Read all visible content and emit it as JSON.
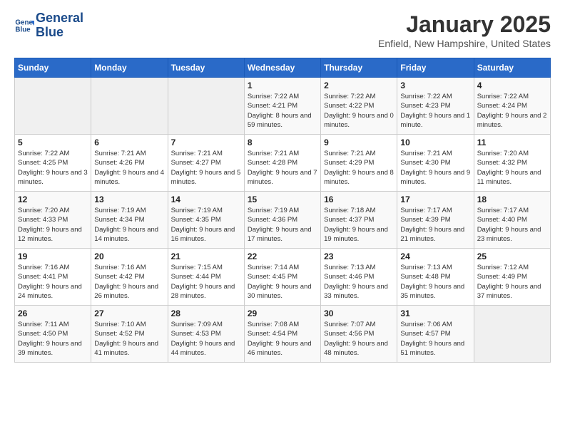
{
  "header": {
    "logo_line1": "General",
    "logo_line2": "Blue",
    "month": "January 2025",
    "location": "Enfield, New Hampshire, United States"
  },
  "weekdays": [
    "Sunday",
    "Monday",
    "Tuesday",
    "Wednesday",
    "Thursday",
    "Friday",
    "Saturday"
  ],
  "weeks": [
    [
      {
        "day": "",
        "info": ""
      },
      {
        "day": "",
        "info": ""
      },
      {
        "day": "",
        "info": ""
      },
      {
        "day": "1",
        "info": "Sunrise: 7:22 AM\nSunset: 4:21 PM\nDaylight: 8 hours and 59 minutes."
      },
      {
        "day": "2",
        "info": "Sunrise: 7:22 AM\nSunset: 4:22 PM\nDaylight: 9 hours and 0 minutes."
      },
      {
        "day": "3",
        "info": "Sunrise: 7:22 AM\nSunset: 4:23 PM\nDaylight: 9 hours and 1 minute."
      },
      {
        "day": "4",
        "info": "Sunrise: 7:22 AM\nSunset: 4:24 PM\nDaylight: 9 hours and 2 minutes."
      }
    ],
    [
      {
        "day": "5",
        "info": "Sunrise: 7:22 AM\nSunset: 4:25 PM\nDaylight: 9 hours and 3 minutes."
      },
      {
        "day": "6",
        "info": "Sunrise: 7:21 AM\nSunset: 4:26 PM\nDaylight: 9 hours and 4 minutes."
      },
      {
        "day": "7",
        "info": "Sunrise: 7:21 AM\nSunset: 4:27 PM\nDaylight: 9 hours and 5 minutes."
      },
      {
        "day": "8",
        "info": "Sunrise: 7:21 AM\nSunset: 4:28 PM\nDaylight: 9 hours and 7 minutes."
      },
      {
        "day": "9",
        "info": "Sunrise: 7:21 AM\nSunset: 4:29 PM\nDaylight: 9 hours and 8 minutes."
      },
      {
        "day": "10",
        "info": "Sunrise: 7:21 AM\nSunset: 4:30 PM\nDaylight: 9 hours and 9 minutes."
      },
      {
        "day": "11",
        "info": "Sunrise: 7:20 AM\nSunset: 4:32 PM\nDaylight: 9 hours and 11 minutes."
      }
    ],
    [
      {
        "day": "12",
        "info": "Sunrise: 7:20 AM\nSunset: 4:33 PM\nDaylight: 9 hours and 12 minutes."
      },
      {
        "day": "13",
        "info": "Sunrise: 7:19 AM\nSunset: 4:34 PM\nDaylight: 9 hours and 14 minutes."
      },
      {
        "day": "14",
        "info": "Sunrise: 7:19 AM\nSunset: 4:35 PM\nDaylight: 9 hours and 16 minutes."
      },
      {
        "day": "15",
        "info": "Sunrise: 7:19 AM\nSunset: 4:36 PM\nDaylight: 9 hours and 17 minutes."
      },
      {
        "day": "16",
        "info": "Sunrise: 7:18 AM\nSunset: 4:37 PM\nDaylight: 9 hours and 19 minutes."
      },
      {
        "day": "17",
        "info": "Sunrise: 7:17 AM\nSunset: 4:39 PM\nDaylight: 9 hours and 21 minutes."
      },
      {
        "day": "18",
        "info": "Sunrise: 7:17 AM\nSunset: 4:40 PM\nDaylight: 9 hours and 23 minutes."
      }
    ],
    [
      {
        "day": "19",
        "info": "Sunrise: 7:16 AM\nSunset: 4:41 PM\nDaylight: 9 hours and 24 minutes."
      },
      {
        "day": "20",
        "info": "Sunrise: 7:16 AM\nSunset: 4:42 PM\nDaylight: 9 hours and 26 minutes."
      },
      {
        "day": "21",
        "info": "Sunrise: 7:15 AM\nSunset: 4:44 PM\nDaylight: 9 hours and 28 minutes."
      },
      {
        "day": "22",
        "info": "Sunrise: 7:14 AM\nSunset: 4:45 PM\nDaylight: 9 hours and 30 minutes."
      },
      {
        "day": "23",
        "info": "Sunrise: 7:13 AM\nSunset: 4:46 PM\nDaylight: 9 hours and 33 minutes."
      },
      {
        "day": "24",
        "info": "Sunrise: 7:13 AM\nSunset: 4:48 PM\nDaylight: 9 hours and 35 minutes."
      },
      {
        "day": "25",
        "info": "Sunrise: 7:12 AM\nSunset: 4:49 PM\nDaylight: 9 hours and 37 minutes."
      }
    ],
    [
      {
        "day": "26",
        "info": "Sunrise: 7:11 AM\nSunset: 4:50 PM\nDaylight: 9 hours and 39 minutes."
      },
      {
        "day": "27",
        "info": "Sunrise: 7:10 AM\nSunset: 4:52 PM\nDaylight: 9 hours and 41 minutes."
      },
      {
        "day": "28",
        "info": "Sunrise: 7:09 AM\nSunset: 4:53 PM\nDaylight: 9 hours and 44 minutes."
      },
      {
        "day": "29",
        "info": "Sunrise: 7:08 AM\nSunset: 4:54 PM\nDaylight: 9 hours and 46 minutes."
      },
      {
        "day": "30",
        "info": "Sunrise: 7:07 AM\nSunset: 4:56 PM\nDaylight: 9 hours and 48 minutes."
      },
      {
        "day": "31",
        "info": "Sunrise: 7:06 AM\nSunset: 4:57 PM\nDaylight: 9 hours and 51 minutes."
      },
      {
        "day": "",
        "info": ""
      }
    ]
  ]
}
